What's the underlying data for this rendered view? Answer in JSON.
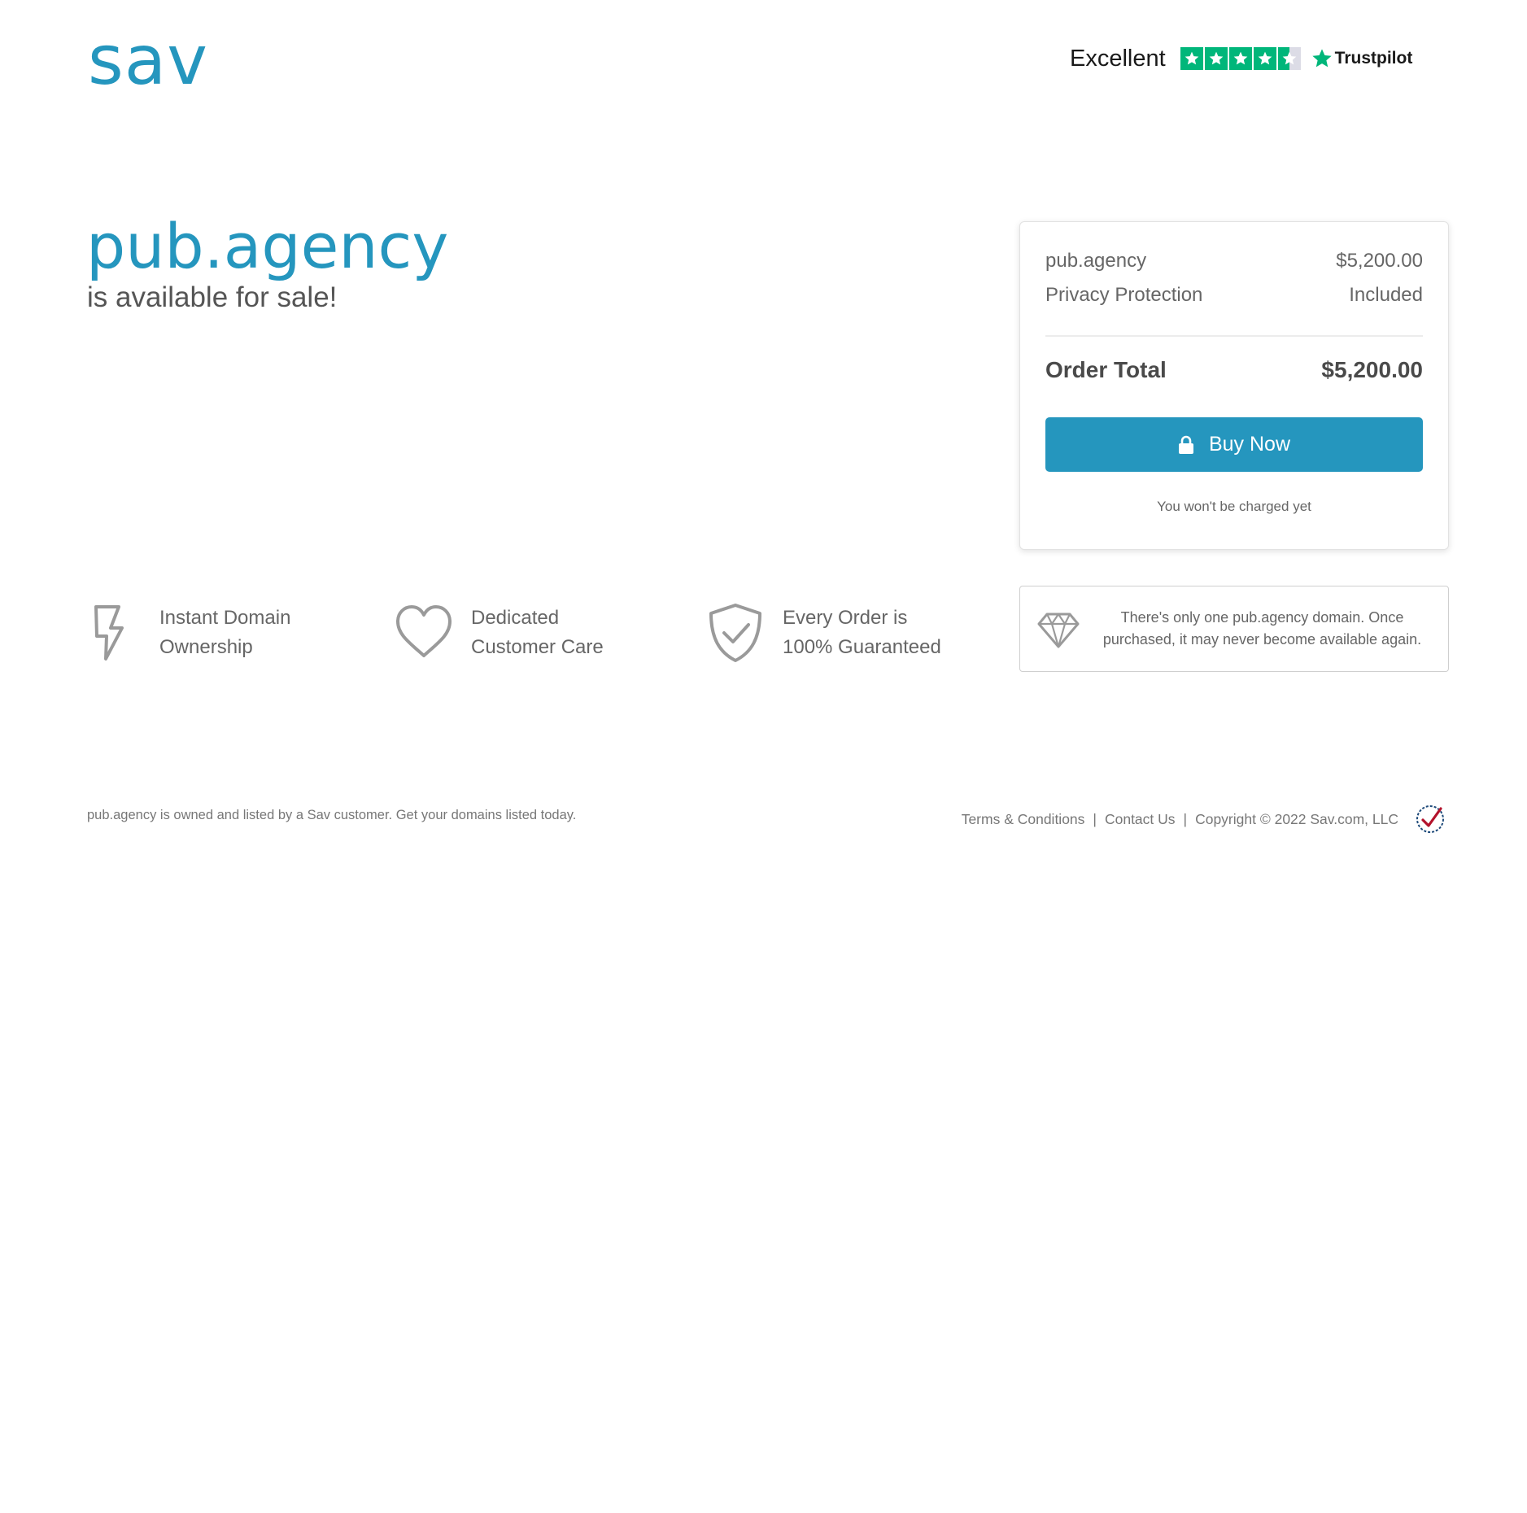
{
  "header": {
    "logo_text": "sav",
    "trustpilot": {
      "rating_word": "Excellent",
      "stars_filled": 4.5,
      "stars_total": 5,
      "brand_label": "Trustpilot",
      "brand_color": "#00b67a"
    }
  },
  "hero": {
    "domain": "pub.agency",
    "subtitle": "is available for sale!"
  },
  "order": {
    "line_items": [
      {
        "label": "pub.agency",
        "value": "$5,200.00"
      },
      {
        "label": "Privacy Protection",
        "value": "Included"
      }
    ],
    "total_label": "Order Total",
    "total_value": "$5,200.00",
    "buy_button_label": "Buy Now",
    "charge_note": "You won't be charged yet"
  },
  "features": [
    {
      "icon": "lightning-icon",
      "line1": "Instant Domain",
      "line2": "Ownership"
    },
    {
      "icon": "heart-icon",
      "line1": "Dedicated",
      "line2": "Customer Care"
    },
    {
      "icon": "shield-check-icon",
      "line1": "Every Order is",
      "line2": "100% Guaranteed"
    }
  ],
  "notice": {
    "icon": "diamond-icon",
    "line1": "There's only one pub.agency domain. Once",
    "line2": "purchased, it may never become available again."
  },
  "footer": {
    "left_text": "pub.agency is owned and listed by a Sav customer. Get your domains listed today.",
    "links": [
      "Terms & Conditions",
      "Contact Us"
    ],
    "separator": "|",
    "copyright": "Copyright © 2022 Sav.com, LLC",
    "badge_icon": "icann-badge-icon"
  },
  "colors": {
    "accent": "#2596be",
    "text": "#555555",
    "trustpilot_green": "#00b67a"
  }
}
